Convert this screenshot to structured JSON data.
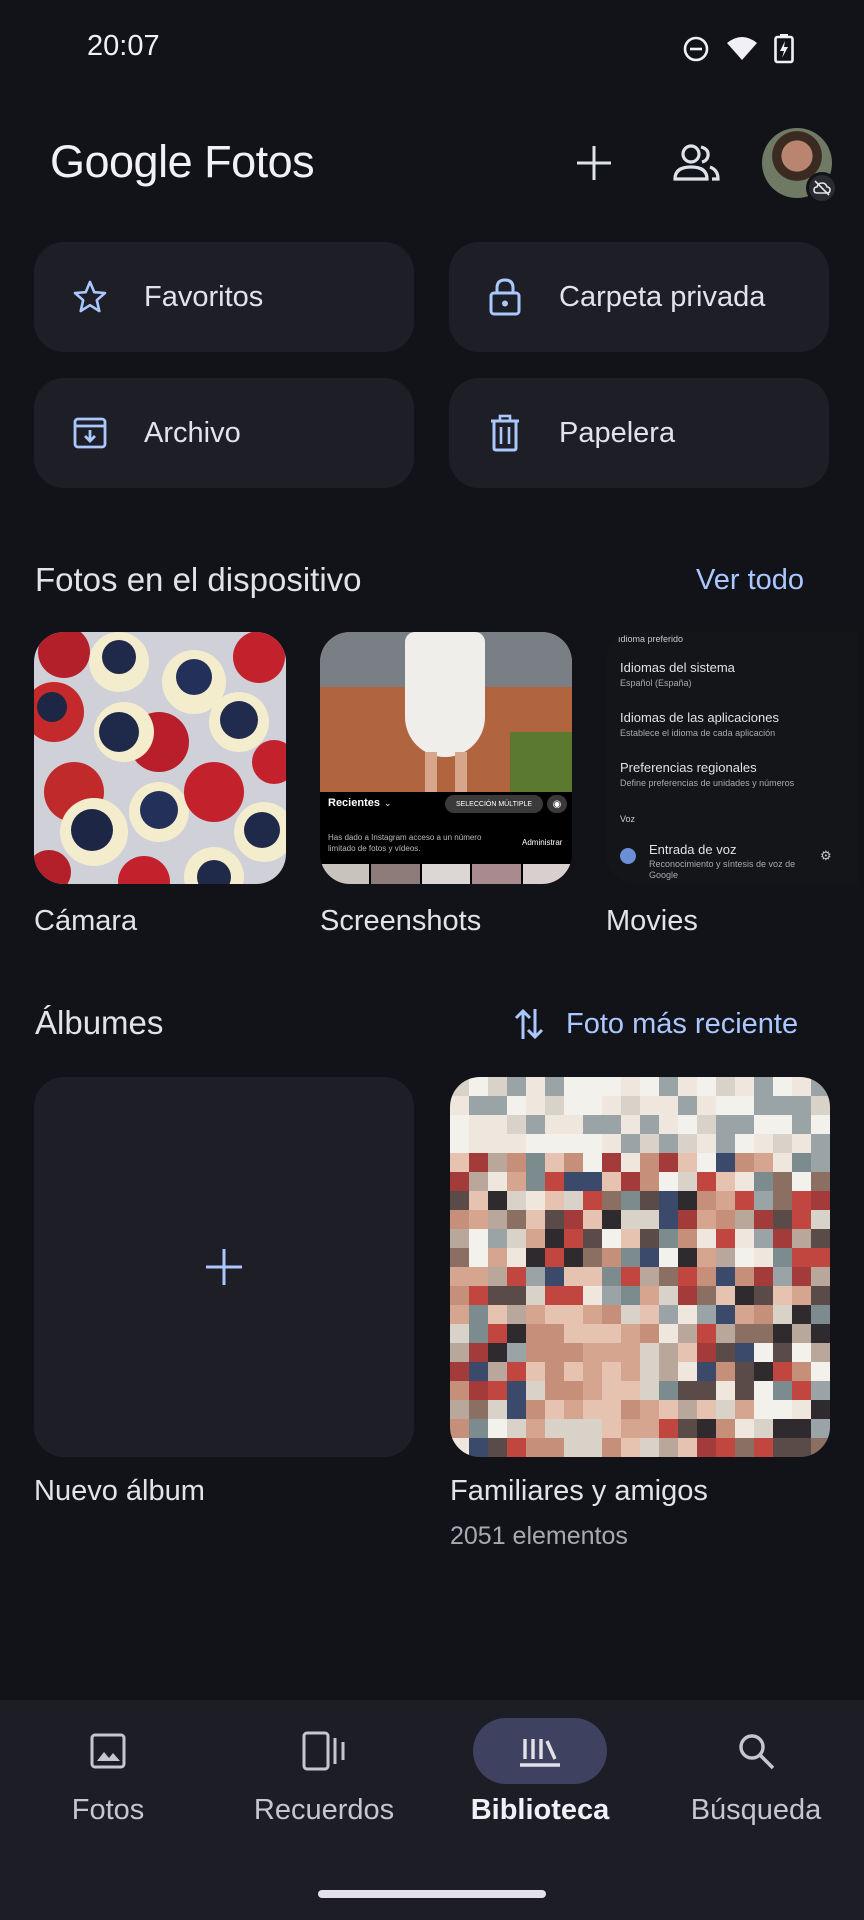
{
  "status_bar": {
    "time": "20:07"
  },
  "header": {
    "logo_brand": "Google",
    "logo_product": "Fotos"
  },
  "quick_actions": [
    {
      "label": "Favoritos",
      "icon": "star-icon"
    },
    {
      "label": "Carpeta privada",
      "icon": "lock-icon"
    },
    {
      "label": "Archivo",
      "icon": "archive-icon"
    },
    {
      "label": "Papelera",
      "icon": "trash-icon"
    }
  ],
  "device_section": {
    "title": "Fotos en el dispositivo",
    "link": "Ver todo",
    "folders": [
      {
        "label": "Cámara"
      },
      {
        "label": "Screenshots",
        "preview": {
          "recents": "Recientes",
          "multi_select": "SELECCIÓN MÚLTIPLE",
          "notice": "Has dado a Instagram acceso a un número limitado de fotos y vídeos.",
          "manage": "Administrar"
        }
      },
      {
        "label": "Movies",
        "preview": {
          "header": "Idioma preferido",
          "items": [
            {
              "title": "Idiomas del sistema",
              "sub": "Español (España)"
            },
            {
              "title": "Idiomas de las aplicaciones",
              "sub": "Establece el idioma de cada aplicación"
            },
            {
              "title": "Preferencias regionales",
              "sub": "Define preferencias de unidades y números"
            }
          ],
          "voice_header": "Voz",
          "voice_title": "Entrada de voz",
          "voice_sub": "Reconocimiento y síntesis de voz de Google"
        }
      }
    ]
  },
  "albums_section": {
    "title": "Álbumes",
    "sort_label": "Foto más reciente",
    "albums": [
      {
        "title": "Nuevo álbum"
      },
      {
        "title": "Familiares y amigos",
        "count": "2051 elementos"
      }
    ]
  },
  "bottom_nav": [
    {
      "label": "Fotos",
      "icon": "photo-icon",
      "active": false
    },
    {
      "label": "Recuerdos",
      "icon": "memories-icon",
      "active": false
    },
    {
      "label": "Biblioteca",
      "icon": "library-icon",
      "active": true
    },
    {
      "label": "Búsqueda",
      "icon": "search-icon",
      "active": false
    }
  ],
  "colors": {
    "background": "#121318",
    "surface": "#1e1f26",
    "accent": "#aac7ff",
    "nav_active": "#3e4260"
  }
}
